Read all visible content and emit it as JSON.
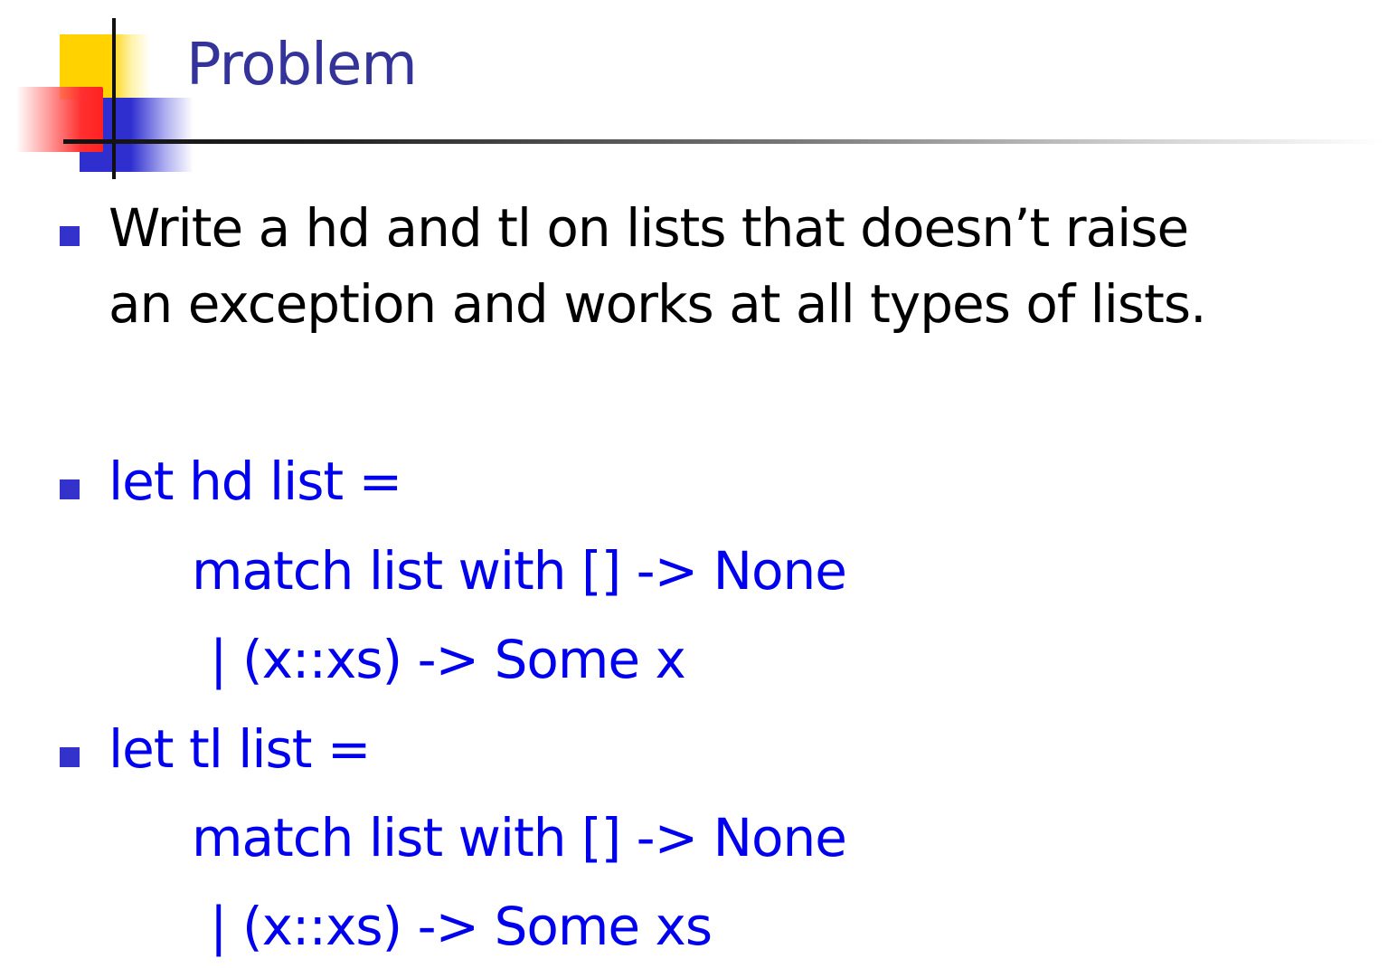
{
  "slide": {
    "title": "Problem",
    "bullets": [
      {
        "lines": [
          "Write a hd and tl on lists that doesn’t raise",
          "an exception and works at all types of lists."
        ]
      },
      {
        "lines": [
          "let hd list =",
          "match list with [] -> None",
          "| (x::xs) -> Some x"
        ]
      },
      {
        "lines": [
          "let tl list =",
          "match list with [] -> None",
          "| (x::xs) -> Some xs"
        ]
      }
    ]
  },
  "colors": {
    "title": "#333399",
    "body_text": "#000000",
    "code_text": "#0000ee",
    "bullet": "#3333cc"
  }
}
